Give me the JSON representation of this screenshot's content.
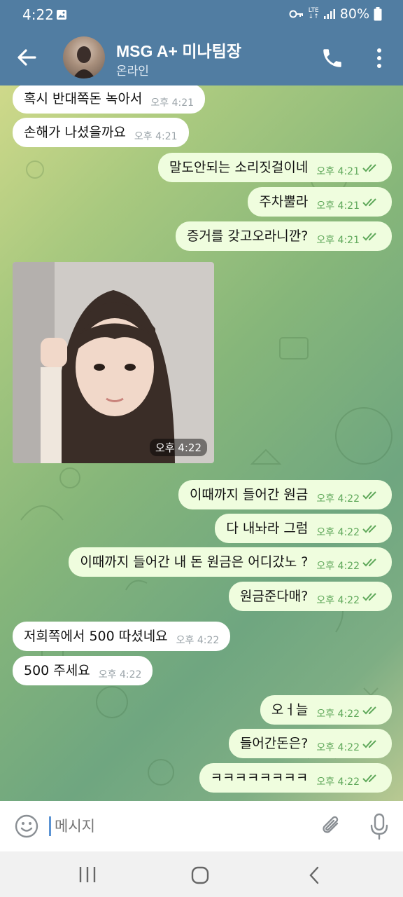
{
  "status_bar": {
    "time": "4:22",
    "network": "LTE",
    "battery": "80%"
  },
  "header": {
    "title": "MSG A+ 미나팀장",
    "status": "온라인"
  },
  "messages": [
    {
      "dir": "in",
      "text": "혹시 반대쪽돈 녹아서",
      "time": "오후 4:21"
    },
    {
      "dir": "in",
      "text": "손해가 나셨을까요",
      "time": "오후 4:21"
    },
    {
      "dir": "out",
      "text": "말도안되는 소리짓걸이네",
      "time": "오후 4:21"
    },
    {
      "dir": "out",
      "text": "주차뿔라",
      "time": "오후 4:21"
    },
    {
      "dir": "out",
      "text": "증거를 갖고오라니깐?",
      "time": "오후 4:21"
    },
    {
      "dir": "in",
      "type": "photo",
      "time": "오후 4:22"
    },
    {
      "dir": "out",
      "text": "이때까지 들어간 원금",
      "time": "오후 4:22"
    },
    {
      "dir": "out",
      "text": "다 내놔라 그럼",
      "time": "오후 4:22"
    },
    {
      "dir": "out",
      "text": "이때까지 들어간 내 돈 원금은 어디갔노 ?",
      "time": "오후 4:22"
    },
    {
      "dir": "out",
      "text": "원금준다매?",
      "time": "오후 4:22"
    },
    {
      "dir": "in",
      "text": "저희쪽에서 500 따셨네요",
      "time": "오후 4:22"
    },
    {
      "dir": "in",
      "text": "500 주세요",
      "time": "오후 4:22"
    },
    {
      "dir": "out",
      "text": "오ㅓ늘",
      "time": "오후 4:22"
    },
    {
      "dir": "out",
      "text": "들어간돈은?",
      "time": "오후 4:22"
    },
    {
      "dir": "out",
      "text": "ㅋㅋㅋㅋㅋㅋㅋㅋ",
      "time": "오후 4:22"
    }
  ],
  "input": {
    "placeholder": "메시지"
  },
  "icons": {
    "back": "arrow-left-icon",
    "call": "phone-icon",
    "menu": "more-vertical-icon",
    "emoji": "smiley-icon",
    "attach": "paperclip-icon",
    "mic": "microphone-icon",
    "read": "double-check-icon"
  },
  "colors": {
    "header_bg": "#517da2",
    "outgoing_bubble": "#effdde",
    "incoming_bubble": "#ffffff",
    "time_outgoing": "#5fa85a"
  }
}
